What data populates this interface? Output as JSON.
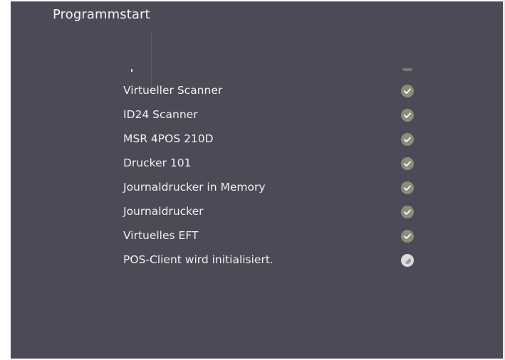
{
  "window": {
    "title": "Programmstart"
  },
  "devices": [
    {
      "label": "Virtueller Scanner",
      "status": "ok"
    },
    {
      "label": "ID24 Scanner",
      "status": "ok"
    },
    {
      "label": "MSR 4POS 210D",
      "status": "ok"
    },
    {
      "label": "Drucker 101",
      "status": "ok"
    },
    {
      "label": "Journaldrucker in Memory",
      "status": "ok"
    },
    {
      "label": "Journaldrucker",
      "status": "ok"
    },
    {
      "label": "Virtuelles EFT",
      "status": "ok"
    },
    {
      "label": "POS-Client wird initialisiert.",
      "status": "loading"
    }
  ],
  "icons": {
    "ok": "check-circle-icon",
    "loading": "spinner-icon"
  },
  "colors": {
    "background": "#4b4b58",
    "text": "#f0f0f0",
    "check": "#8d8c78"
  }
}
